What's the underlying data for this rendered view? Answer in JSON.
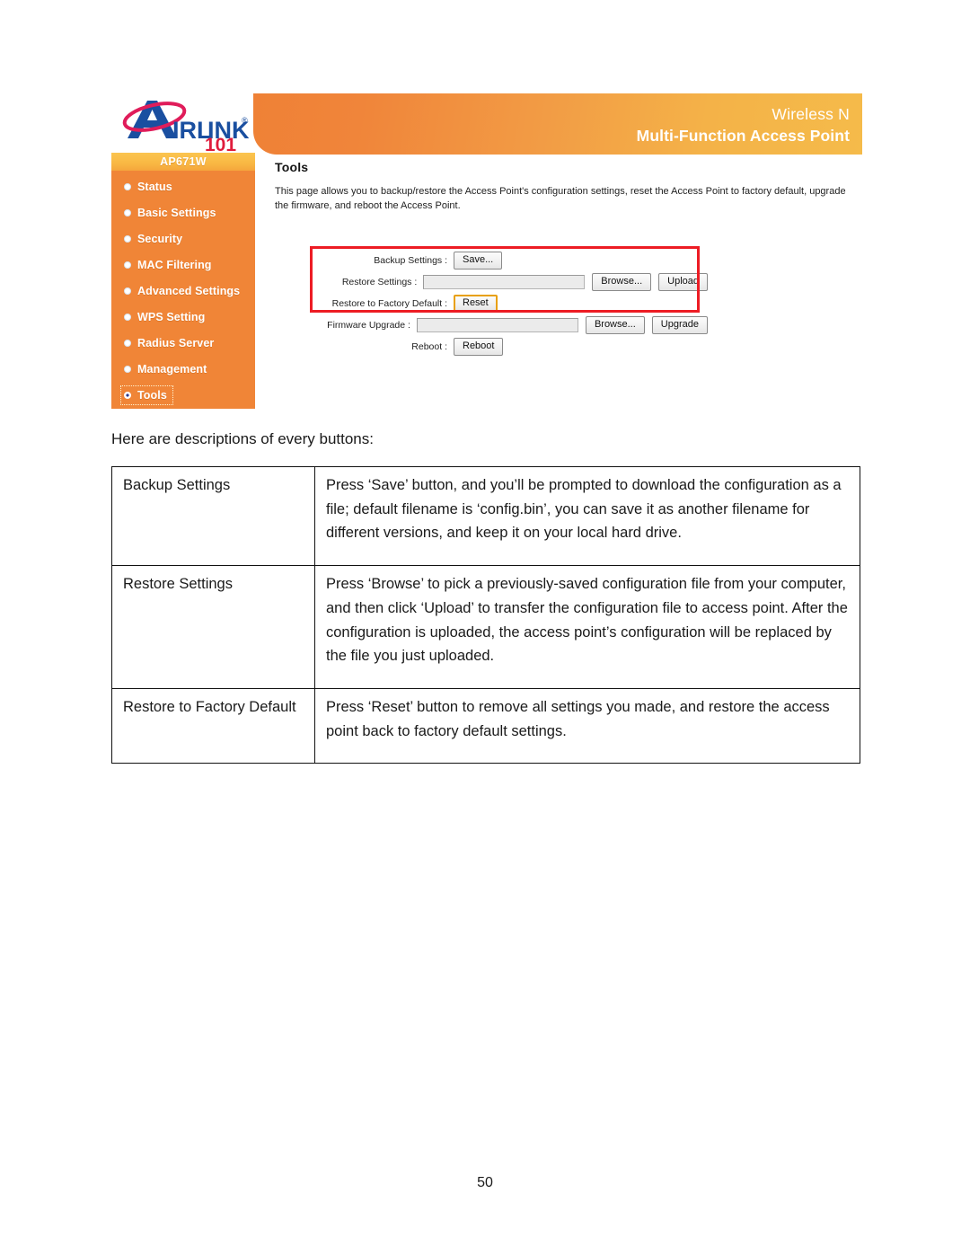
{
  "screenshot": {
    "brand": {
      "logo_text_main": "AIRLINK",
      "logo_text_sub": "101",
      "logo_trademark": "®"
    },
    "banner": {
      "line1": "Wireless N",
      "line2": "Multi-Function Access Point",
      "gradient_from": "#ef8136",
      "gradient_to": "#f5bb4a"
    },
    "sidebar": {
      "model": "AP671W",
      "bg_color": "#f08537",
      "items": [
        {
          "label": "Status",
          "active": false
        },
        {
          "label": "Basic Settings",
          "active": false
        },
        {
          "label": "Security",
          "active": false
        },
        {
          "label": "MAC Filtering",
          "active": false
        },
        {
          "label": "Advanced Settings",
          "active": false
        },
        {
          "label": "WPS Setting",
          "active": false
        },
        {
          "label": "Radius Server",
          "active": false
        },
        {
          "label": "Management",
          "active": false
        },
        {
          "label": "Tools",
          "active": true
        }
      ]
    },
    "panel": {
      "heading": "Tools",
      "description": "This page allows you to backup/restore the Access Point's configuration settings, reset the Access Point to factory default, upgrade the firmware, and reboot the Access Point."
    },
    "highlight": {
      "color": "#ed1c24",
      "note": "red rectangle around the first three form rows"
    },
    "form": {
      "rows": [
        {
          "label": "Backup Settings :",
          "button": "Save...",
          "has_file_input": false,
          "focused": false
        },
        {
          "label": "Restore Settings :",
          "file_value": "",
          "browse_button": "Browse...",
          "action_button": "Upload",
          "has_file_input": true,
          "focused": false
        },
        {
          "label": "Restore to Factory Default :",
          "button": "Reset",
          "has_file_input": false,
          "focused": true
        },
        {
          "label": "Firmware Upgrade :",
          "file_value": "",
          "browse_button": "Browse...",
          "action_button": "Upgrade",
          "has_file_input": true,
          "focused": false
        },
        {
          "label": "Reboot :",
          "button": "Reboot",
          "has_file_input": false,
          "focused": false
        }
      ]
    }
  },
  "document": {
    "intro": "Here are descriptions of every buttons:",
    "table": {
      "rows": [
        {
          "term": "Backup Settings",
          "description": "Press ‘Save’ button, and you’ll be prompted to download the configuration as a file; default filename is ‘config.bin’, you can save it as another filename for different versions, and keep it on your local hard drive."
        },
        {
          "term": "Restore Settings",
          "description": "Press ‘Browse’ to pick a previously-saved configuration file from your computer, and then click ‘Upload’ to transfer the configuration file to access point. After the configuration is uploaded, the access point’s configuration will be replaced by the file you just uploaded."
        },
        {
          "term": "Restore to Factory Default",
          "description": "Press ‘Reset’ button to remove all settings you made, and restore the access point back to factory default settings."
        }
      ]
    },
    "page_number": "50"
  }
}
